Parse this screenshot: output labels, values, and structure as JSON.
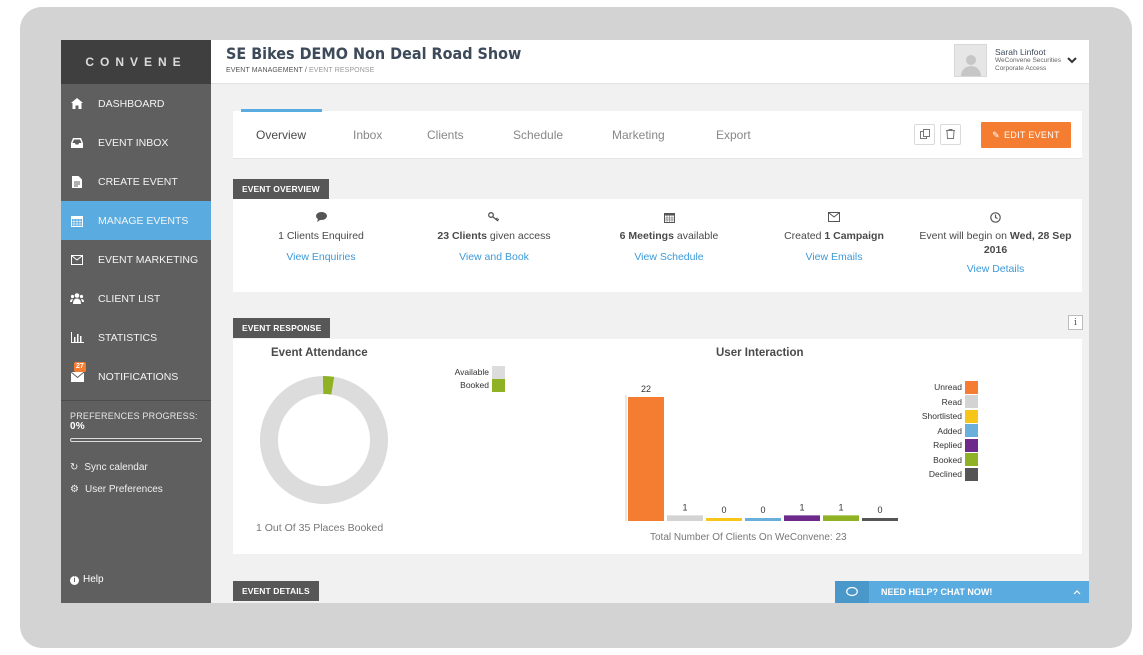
{
  "sidebar": {
    "logo": "CONVENE",
    "items": [
      {
        "label": "DASHBOARD",
        "icon": "home-icon"
      },
      {
        "label": "EVENT INBOX",
        "icon": "inbox-icon"
      },
      {
        "label": "CREATE EVENT",
        "icon": "file-icon"
      },
      {
        "label": "MANAGE EVENTS",
        "icon": "calendar-icon"
      },
      {
        "label": "EVENT MARKETING",
        "icon": "envelope-icon"
      },
      {
        "label": "CLIENT LIST",
        "icon": "users-icon"
      },
      {
        "label": "STATISTICS",
        "icon": "bar-chart-icon"
      },
      {
        "label": "NOTIFICATIONS",
        "icon": "mail-icon",
        "badge": "27"
      }
    ],
    "pref_label": "PREFERENCES PROGRESS:",
    "pref_value": "0%",
    "sync": "Sync calendar",
    "prefs": "User Preferences",
    "help": "Help"
  },
  "header": {
    "title": "SE Bikes DEMO Non Deal Road Show",
    "crumb_root": "EVENT MANAGEMENT /",
    "crumb_current": "EVENT RESPONSE",
    "user_name": "Sarah Linfoot",
    "user_company": "WeConvene Securities",
    "user_role": "Corporate Access"
  },
  "tabs": [
    "Overview",
    "Inbox",
    "Clients",
    "Schedule",
    "Marketing",
    "Export"
  ],
  "edit_button": "EDIT EVENT",
  "overview": {
    "label": "EVENT OVERVIEW",
    "col1": {
      "text": "1 Clients Enquired",
      "link": "View Enquiries"
    },
    "col2": {
      "bold": "23 Clients",
      "text": " given access",
      "link": "View and Book"
    },
    "col3": {
      "bold": "6 Meetings",
      "text": " available",
      "link": "View Schedule"
    },
    "col4": {
      "text": "Created ",
      "bold": "1 Campaign",
      "link": "View Emails"
    },
    "col5": {
      "text": "Event will begin on ",
      "bold": "Wed, 28 Sep 2016",
      "link": "View Details"
    }
  },
  "response": {
    "label": "EVENT RESPONSE",
    "attendance_title": "Event Attendance",
    "interaction_title": "User Interaction",
    "places": "1 Out Of 35 Places Booked",
    "total": "Total Number Of Clients On WeConvene: 23"
  },
  "details_label": "EVENT DETAILS",
  "chat_label": "NEED HELP? CHAT NOW!",
  "chart_data": [
    {
      "type": "pie",
      "title": "Event Attendance",
      "labels": [
        "Available",
        "Booked"
      ],
      "values": [
        34,
        1
      ],
      "colors": [
        "#dcdcdc",
        "#8fb224"
      ]
    },
    {
      "type": "bar",
      "title": "User Interaction",
      "categories": [
        "Unread",
        "Read",
        "Shortlisted",
        "Added",
        "Replied",
        "Booked",
        "Declined"
      ],
      "values": [
        22,
        1,
        0,
        0,
        1,
        1,
        0
      ],
      "colors": [
        "#f47d32",
        "#d3d3d3",
        "#f5c518",
        "#6aaedc",
        "#6d2a8a",
        "#8fb224",
        "#555555"
      ],
      "ylim": [
        0,
        22
      ]
    }
  ]
}
